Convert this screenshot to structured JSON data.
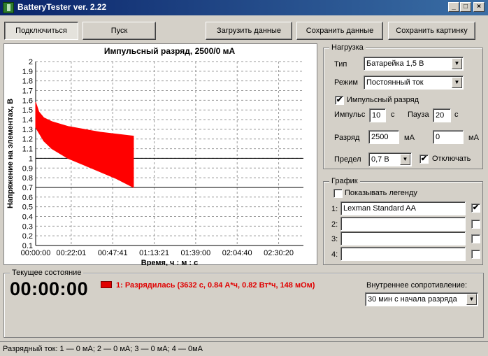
{
  "window": {
    "title": "BatteryTester ver. 2.22"
  },
  "toolbar": {
    "connect": "Подключиться",
    "start": "Пуск",
    "load": "Загрузить данные",
    "save": "Сохранить данные",
    "save_image": "Сохранить картинку"
  },
  "chart_data": {
    "type": "area",
    "title": "Импульсный разряд, 2500/0 мА",
    "xlabel": "Время, ч : м : с",
    "ylabel": "Напряжение на элементах, В",
    "ylim": [
      0.1,
      2.0
    ],
    "xlim_seconds": [
      0,
      9940
    ],
    "x_ticks": [
      "00:00:00",
      "00:22:01",
      "00:47:41",
      "01:13:21",
      "01:39:00",
      "02:04:40",
      "02:30:20"
    ],
    "y_ticks": [
      "0.1",
      "0.2",
      "0.3",
      "0.4",
      "0.5",
      "0.6",
      "0.7",
      "0.8",
      "0.9",
      "1",
      "1.1",
      "1.2",
      "1.3",
      "1.4",
      "1.5",
      "1.6",
      "1.7",
      "1.8",
      "1.9",
      "2"
    ],
    "reference_lines": [
      1.0,
      0.7
    ],
    "series": [
      {
        "color": "#ff0000",
        "upper": {
          "x": [
            "00:00:00",
            "00:02:00",
            "00:05:00",
            "00:10:00",
            "00:20:00",
            "00:30:00",
            "00:40:00",
            "00:50:00",
            "01:00:32"
          ],
          "y": [
            1.58,
            1.48,
            1.42,
            1.38,
            1.33,
            1.3,
            1.27,
            1.25,
            1.23
          ]
        },
        "lower": {
          "x": [
            "00:00:00",
            "00:05:00",
            "00:10:00",
            "00:20:00",
            "00:30:00",
            "00:40:00",
            "00:50:00",
            "01:00:32"
          ],
          "y": [
            1.32,
            1.18,
            1.1,
            1.0,
            0.93,
            0.86,
            0.79,
            0.7
          ]
        }
      }
    ]
  },
  "load_group": {
    "title": "Нагрузка",
    "type_label": "Тип",
    "type_value": "Батарейка 1,5 В",
    "mode_label": "Режим",
    "mode_value": "Постоянный ток",
    "pulse_check_label": "Импульсный разряд",
    "pulse_label": "Импульс",
    "pulse_value": "10",
    "pulse_unit": "с",
    "pause_label": "Пауза",
    "pause_value": "20",
    "pause_unit": "с",
    "discharge_label": "Разряд",
    "discharge_value": "2500",
    "discharge_unit": "мА",
    "discharge_value2": "0",
    "discharge_unit2": "мА",
    "limit_label": "Предел",
    "limit_value": "0,7 В",
    "cutoff_label": "Отключать"
  },
  "graph_group": {
    "title": "График",
    "legend_label": "Показывать легенду",
    "slots": [
      {
        "num": "1:",
        "value": "Lexman Standard AA",
        "checked": true
      },
      {
        "num": "2:",
        "value": "",
        "checked": false
      },
      {
        "num": "3:",
        "value": "",
        "checked": false
      },
      {
        "num": "4:",
        "value": "",
        "checked": false
      }
    ]
  },
  "state": {
    "title": "Текущее состояние",
    "time": "00:00:00",
    "message": "1: Разрядилась (3632 с, 0.84 А*ч, 0.82 Вт*ч, 148 мОм)",
    "resistance_label": "Внутреннее сопротивление:",
    "resistance_value": "30 мин с начала разряда"
  },
  "statusbar": {
    "text": "Разрядный ток: 1 — 0 мА; 2 — 0 мА; 3 — 0 мА; 4 — 0мА"
  },
  "check_mark": "✔"
}
